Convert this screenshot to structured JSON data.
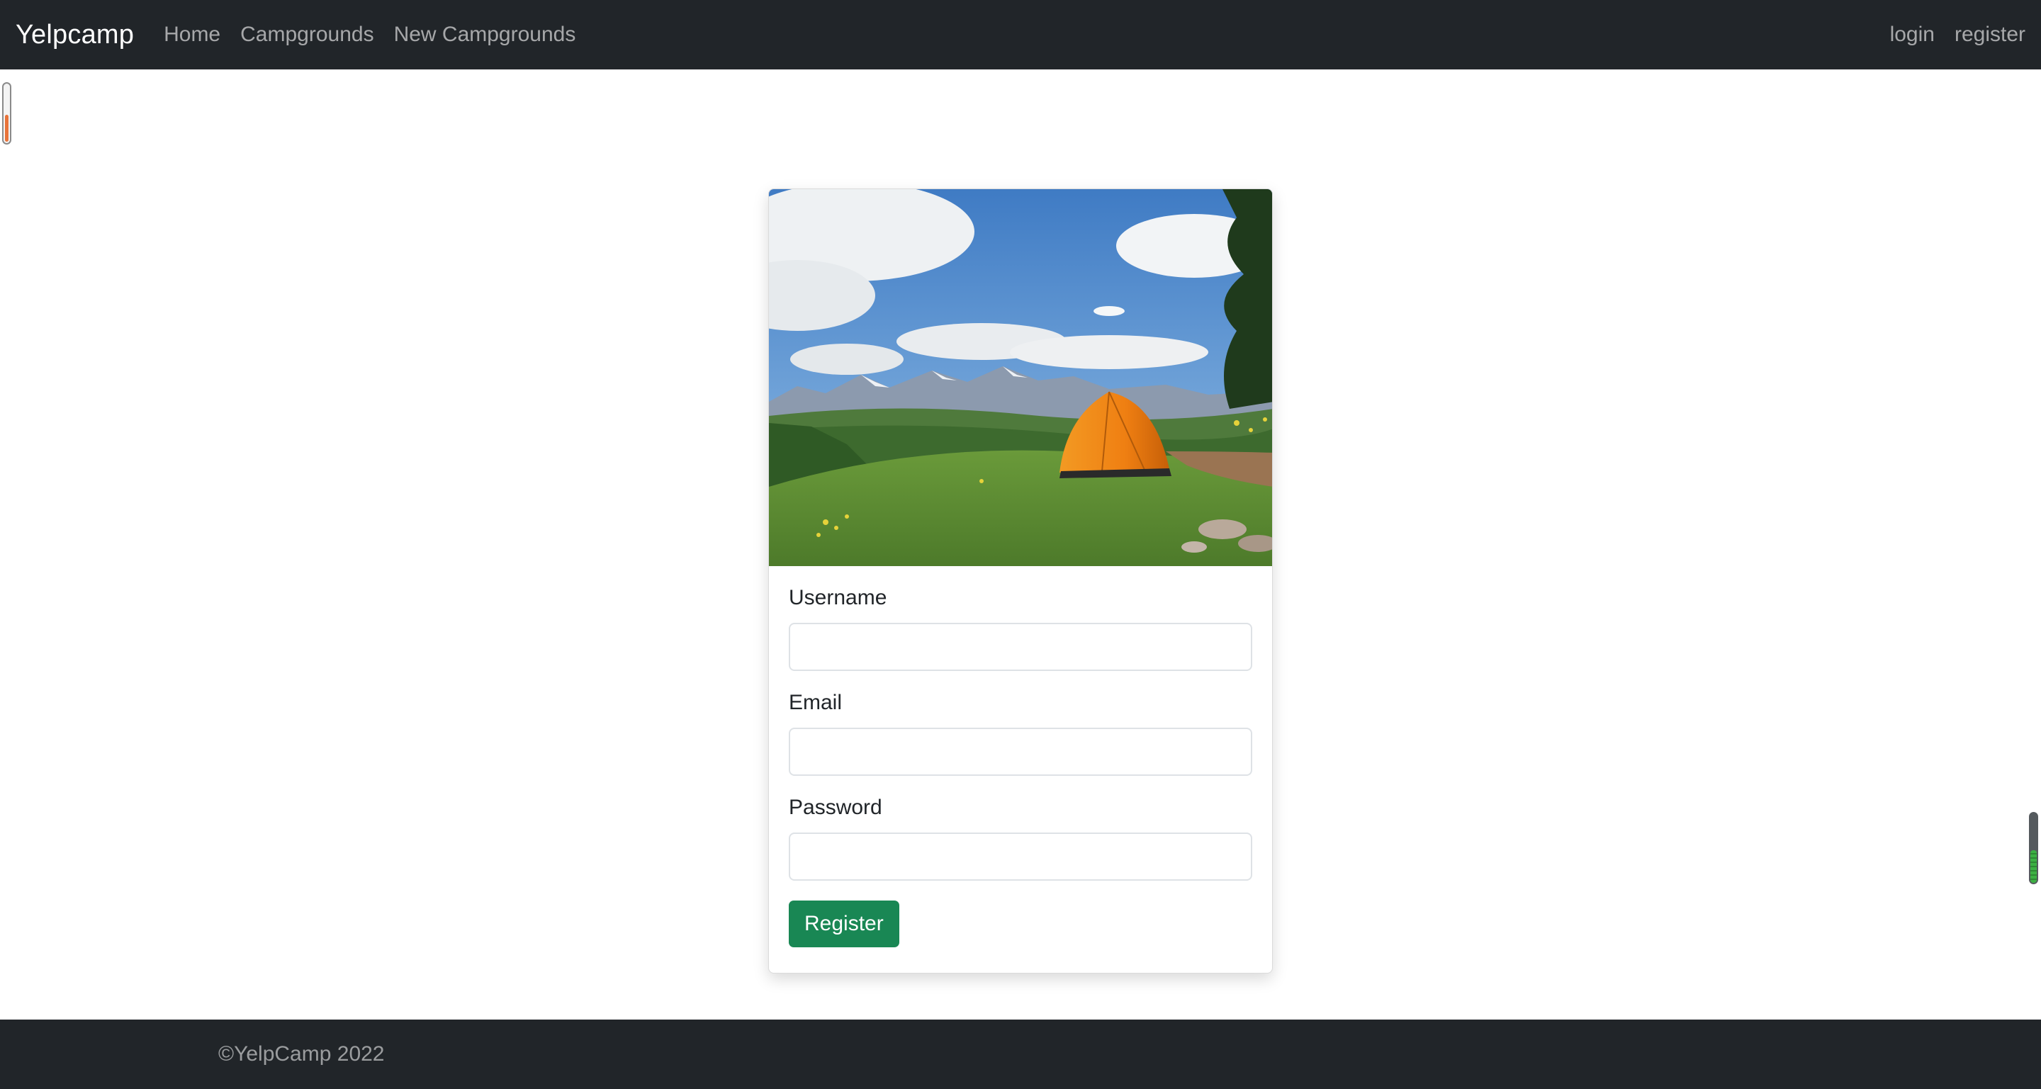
{
  "navbar": {
    "brand": "Yelpcamp",
    "links": [
      {
        "label": "Home"
      },
      {
        "label": "Campgrounds"
      },
      {
        "label": "New Campgrounds"
      }
    ],
    "right_links": [
      {
        "label": "login"
      },
      {
        "label": "register"
      }
    ]
  },
  "card": {
    "image_icon": "campground-photo",
    "fields": [
      {
        "label": "Username",
        "value": "",
        "placeholder": ""
      },
      {
        "label": "Email",
        "value": "",
        "placeholder": ""
      },
      {
        "label": "Password",
        "value": "",
        "placeholder": ""
      }
    ],
    "submit_label": "Register"
  },
  "footer": {
    "copyright": "©YelpCamp 2022"
  },
  "widgets": {
    "left_gauge_level": 0.45,
    "right_gauge_level": 0.45
  },
  "colors": {
    "navbar_bg": "#212529",
    "register_button": "#198754",
    "tent": "#f08a1c"
  }
}
